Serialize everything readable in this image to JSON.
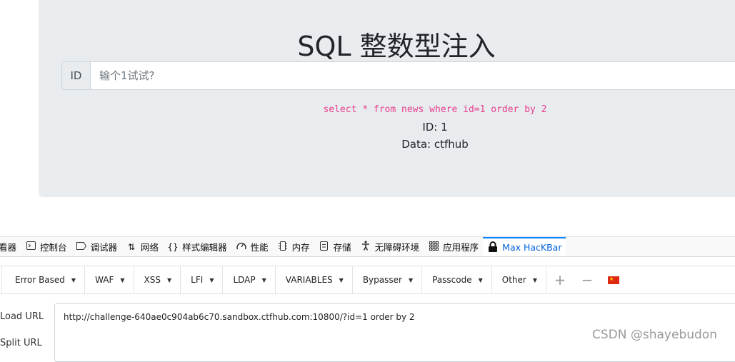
{
  "page": {
    "title": "SQL 整数型注入",
    "input_prefix": "ID",
    "input_placeholder": "输个1试试?",
    "sql_query": "select * from news where id=1 order by 2",
    "result_id": "ID: 1",
    "result_data": "Data: ctfhub"
  },
  "devtools": {
    "tabs": [
      {
        "label": "看器",
        "icon": "inspector-icon"
      },
      {
        "label": "控制台",
        "icon": "console-icon"
      },
      {
        "label": "调试器",
        "icon": "debugger-icon"
      },
      {
        "label": "网络",
        "icon": "network-icon"
      },
      {
        "label": "样式编辑器",
        "icon": "style-editor-icon"
      },
      {
        "label": "性能",
        "icon": "performance-icon"
      },
      {
        "label": "内存",
        "icon": "memory-icon"
      },
      {
        "label": "存储",
        "icon": "storage-icon"
      },
      {
        "label": "无障碍环境",
        "icon": "accessibility-icon"
      },
      {
        "label": "应用程序",
        "icon": "application-icon"
      },
      {
        "label": "Max HacKBar",
        "icon": "lock-icon",
        "active": true
      }
    ],
    "active_color": "#0a84ff"
  },
  "hackbar": {
    "menus": [
      "Error Based",
      "WAF",
      "XSS",
      "LFI",
      "LDAP",
      "VARIABLES",
      "Bypasser",
      "Passcode",
      "Other"
    ],
    "load_url_label": "Load URL",
    "split_url_label": "Split URL",
    "url_value": "http://challenge-640ae0c904ab6c70.sandbox.ctfhub.com:10800/?id=1 order by 2"
  },
  "watermark": "CSDN @shayebudon",
  "colors": {
    "jumbotron": "#e9ecef",
    "sql_code": "#e83e8c"
  }
}
